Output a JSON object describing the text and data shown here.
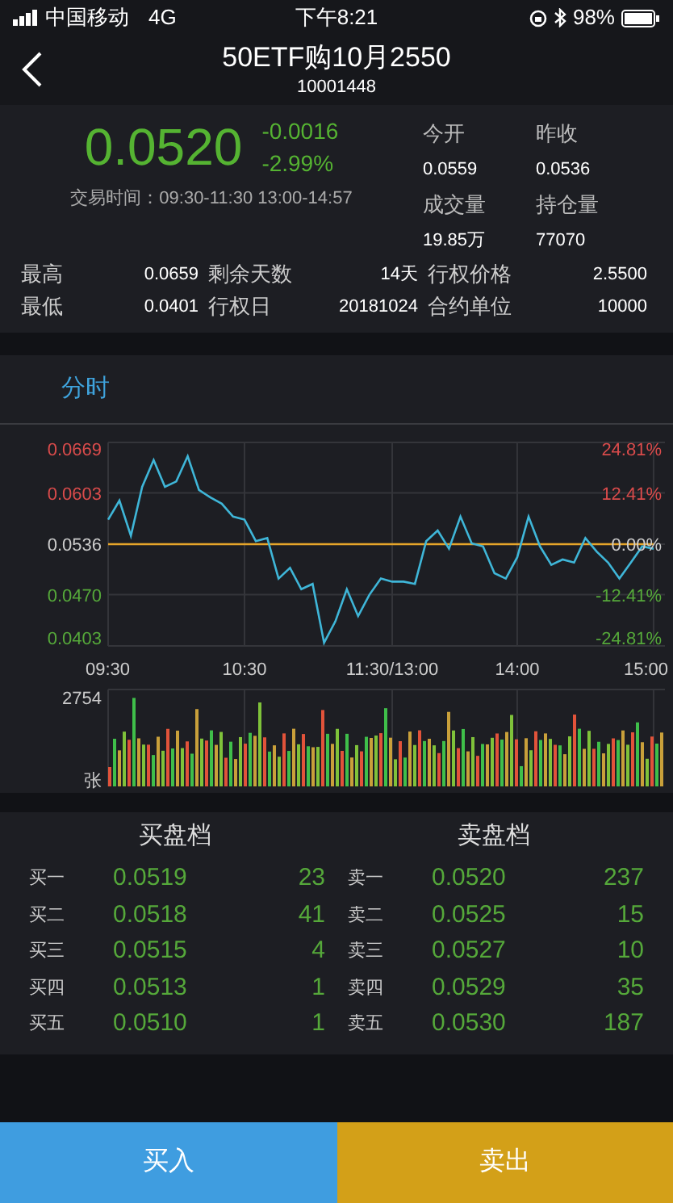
{
  "status_bar": {
    "carrier": "中国移动",
    "network": "4G",
    "time": "下午8:21",
    "battery": "98%"
  },
  "header": {
    "title": "50ETF购10月2550",
    "code": "10001448"
  },
  "quote": {
    "price": "0.0520",
    "change": "-0.0016",
    "change_pct": "-2.99%",
    "trading_hours": "交易时间：09:30-11:30 13:00-14:57",
    "fields": [
      {
        "label": "今开",
        "value": "0.0559"
      },
      {
        "label": "昨收",
        "value": "0.0536"
      },
      {
        "label": "成交量",
        "value": "19.85万"
      },
      {
        "label": "持仓量",
        "value": "77070"
      }
    ]
  },
  "stats": [
    {
      "label": "最高",
      "value": "0.0659"
    },
    {
      "label": "剩余天数",
      "value": "14天"
    },
    {
      "label": "行权价格",
      "value": "2.5500"
    },
    {
      "label": "最低",
      "value": "0.0401"
    },
    {
      "label": "行权日",
      "value": "20181024"
    },
    {
      "label": "合约单位",
      "value": "10000"
    }
  ],
  "tabs": [
    {
      "label": "分时",
      "selected": true
    }
  ],
  "chart": {
    "chart_data": {
      "type": "line",
      "categories": [
        "09:30",
        null,
        null,
        null,
        null,
        null,
        null,
        null,
        null,
        null,
        null,
        null,
        "10:30",
        null,
        null,
        null,
        null,
        null,
        null,
        null,
        null,
        null,
        null,
        null,
        null,
        "11:30/13:00",
        null,
        null,
        null,
        null,
        null,
        null,
        null,
        null,
        null,
        null,
        "14:00",
        null,
        null,
        null,
        null,
        null,
        null,
        null,
        null,
        null,
        null,
        null,
        "15:00"
      ],
      "series": [
        {
          "color": "#e6a52a",
          "values": [
            0.0536,
            0.0536,
            0.0536,
            0.0536,
            0.0536,
            0.0536,
            0.0536,
            0.0536,
            0.0536,
            0.0536,
            0.0536,
            0.0536,
            0.0536,
            0.0536,
            0.0536,
            0.0536,
            0.0536,
            0.0536,
            0.0536,
            0.0536,
            0.0536,
            0.0536,
            0.0536,
            0.0536,
            0.0536,
            0.0536,
            0.0536,
            0.0536,
            0.0536,
            0.0536,
            0.0536,
            0.0536,
            0.0536,
            0.0536,
            0.0536,
            0.0536,
            0.0536,
            0.0536,
            0.0536,
            0.0536,
            0.0536,
            0.0536,
            0.0536,
            0.0536,
            0.0536,
            0.0536,
            0.0536,
            0.0536,
            0.0536
          ]
        },
        {
          "color": "#3fb6d8",
          "values": [
            0.0568,
            0.0593,
            0.0547,
            0.0611,
            0.0646,
            0.0611,
            0.0618,
            0.0651,
            0.0607,
            0.0597,
            0.0589,
            0.0572,
            0.0568,
            0.054,
            0.0544,
            0.0491,
            0.0505,
            0.0477,
            0.0484,
            0.0407,
            0.0435,
            0.0477,
            0.0442,
            0.047,
            0.0491,
            0.0487,
            0.0487,
            0.0484,
            0.054,
            0.0554,
            0.053,
            0.0572,
            0.0537,
            0.0533,
            0.0498,
            0.0491,
            0.0519,
            0.0572,
            0.0533,
            0.0509,
            0.0516,
            0.0512,
            0.0544,
            0.0526,
            0.0512,
            0.0491,
            0.0512,
            0.0533,
            0.053
          ]
        }
      ],
      "ylim": [
        0.0403,
        0.0669
      ],
      "yticks": [
        {
          "value": 0.0669,
          "label": "0.0669"
        },
        {
          "value": 0.0603,
          "label": "0.0603"
        },
        {
          "value": 0.0536,
          "label": "0.0536"
        },
        {
          "value": 0.047,
          "label": "0.0470"
        },
        {
          "value": 0.0403,
          "label": "0.0403"
        }
      ],
      "grid": true
    },
    "pct_labels": [
      "24.81%",
      "12.41%",
      "0.00%",
      "-12.41%",
      "-24.81%"
    ]
  },
  "volume": {
    "max_label": "2754",
    "unit": "张"
  },
  "order_book": {
    "buy_title": "买盘档",
    "sell_title": "卖盘档",
    "buy": [
      {
        "label": "买一",
        "price": "0.0519",
        "qty": "23"
      },
      {
        "label": "买二",
        "price": "0.0518",
        "qty": "41"
      },
      {
        "label": "买三",
        "price": "0.0515",
        "qty": "4"
      },
      {
        "label": "买四",
        "price": "0.0513",
        "qty": "1"
      },
      {
        "label": "买五",
        "price": "0.0510",
        "qty": "1"
      }
    ],
    "sell": [
      {
        "label": "卖一",
        "price": "0.0520",
        "qty": "237"
      },
      {
        "label": "卖二",
        "price": "0.0525",
        "qty": "15"
      },
      {
        "label": "卖三",
        "price": "0.0527",
        "qty": "10"
      },
      {
        "label": "卖四",
        "price": "0.0529",
        "qty": "35"
      },
      {
        "label": "卖五",
        "price": "0.0530",
        "qty": "187"
      }
    ]
  },
  "actions": [
    {
      "label": "买入",
      "kind": "buy"
    },
    {
      "label": "卖出",
      "kind": "sell"
    }
  ]
}
